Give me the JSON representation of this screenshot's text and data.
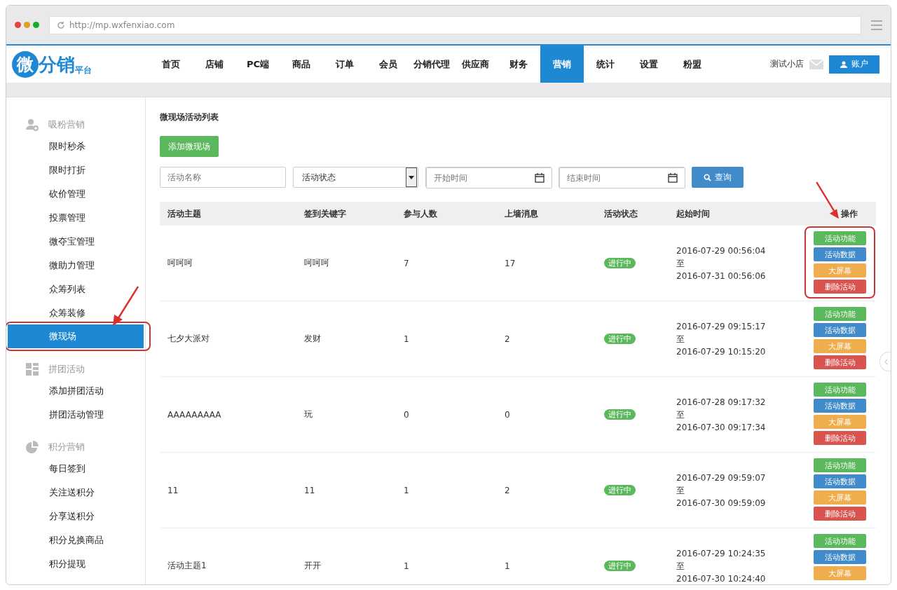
{
  "browser": {
    "url": "http://mp.wxfenxiao.com"
  },
  "header": {
    "logo": "微分销",
    "logo_sub": "平台",
    "nav": [
      {
        "label": "首页",
        "selected": false
      },
      {
        "label": "店铺",
        "selected": false
      },
      {
        "label": "PC端",
        "selected": false
      },
      {
        "label": "商品",
        "selected": false
      },
      {
        "label": "订单",
        "selected": false
      },
      {
        "label": "会员",
        "selected": false
      },
      {
        "label": "分销代理",
        "selected": false
      },
      {
        "label": "供应商",
        "selected": false
      },
      {
        "label": "财务",
        "selected": false
      },
      {
        "label": "营销",
        "selected": true
      },
      {
        "label": "统计",
        "selected": false
      },
      {
        "label": "设置",
        "selected": false
      },
      {
        "label": "粉盟",
        "selected": false
      }
    ],
    "shop": "测试小店",
    "account": "账户"
  },
  "sidebar": {
    "groups": [
      {
        "title": "吸粉营销",
        "kind": "users",
        "items": [
          {
            "label": "限时秒杀",
            "selected": false,
            "highlighted": false
          },
          {
            "label": "限时打折",
            "selected": false,
            "highlighted": false
          },
          {
            "label": "砍价管理",
            "selected": false,
            "highlighted": false
          },
          {
            "label": "投票管理",
            "selected": false,
            "highlighted": false
          },
          {
            "label": "微夺宝管理",
            "selected": false,
            "highlighted": false
          },
          {
            "label": "微助力管理",
            "selected": false,
            "highlighted": false
          },
          {
            "label": "众筹列表",
            "selected": false,
            "highlighted": false
          },
          {
            "label": "众筹装修",
            "selected": false,
            "highlighted": false
          },
          {
            "label": "微现场",
            "selected": true,
            "highlighted": true
          }
        ]
      },
      {
        "title": "拼团活动",
        "kind": "grid",
        "items": [
          {
            "label": "添加拼团活动",
            "selected": false,
            "highlighted": false
          },
          {
            "label": "拼团活动管理",
            "selected": false,
            "highlighted": false
          }
        ]
      },
      {
        "title": "积分营销",
        "kind": "pie",
        "items": [
          {
            "label": "每日签到",
            "selected": false,
            "highlighted": false
          },
          {
            "label": "关注送积分",
            "selected": false,
            "highlighted": false
          },
          {
            "label": "分享送积分",
            "selected": false,
            "highlighted": false
          },
          {
            "label": "积分兑换商品",
            "selected": false,
            "highlighted": false
          },
          {
            "label": "积分提现",
            "selected": false,
            "highlighted": false
          }
        ]
      }
    ]
  },
  "content": {
    "title": "微现场活动列表",
    "add_button": "添加微现场",
    "filters": {
      "name": {
        "placeholder": "活动名称"
      },
      "status": {
        "value": "活动状态"
      },
      "start": {
        "placeholder": "开始时间"
      },
      "end": {
        "placeholder": "结束时间"
      },
      "search": "查询"
    },
    "table": {
      "columns": [
        "活动主题",
        "签到关键字",
        "参与人数",
        "上墙消息",
        "活动状态",
        "起始时间",
        "操作"
      ],
      "actions_highlighted": true,
      "rows": [
        {
          "cells": [
            "呵呵呵",
            "呵呵呵",
            "7",
            "17"
          ],
          "status": "进行中",
          "start": "2016-07-29 00:56:04",
          "to": "至",
          "end": "2016-07-31 00:56:06",
          "highlighted": true,
          "actions": [
            {
              "label": "活动功能",
              "color": "#5cb85c"
            },
            {
              "label": "活动数据",
              "color": "#428bca"
            },
            {
              "label": "大屏幕",
              "color": "#f0ad4e"
            },
            {
              "label": "删除活动",
              "color": "#d9534f"
            }
          ]
        },
        {
          "cells": [
            "七夕大派对",
            "发财",
            "1",
            "2"
          ],
          "status": "进行中",
          "start": "2016-07-29 09:15:17",
          "to": "至",
          "end": "2016-07-29 10:15:20",
          "highlighted": false,
          "actions": [
            {
              "label": "活动功能",
              "color": "#5cb85c"
            },
            {
              "label": "活动数据",
              "color": "#428bca"
            },
            {
              "label": "大屏幕",
              "color": "#f0ad4e"
            },
            {
              "label": "删除活动",
              "color": "#d9534f"
            }
          ]
        },
        {
          "cells": [
            "AAAAAAAAA",
            "玩",
            "0",
            "0"
          ],
          "status": "进行中",
          "start": "2016-07-28 09:17:32",
          "to": "至",
          "end": "2016-07-30 09:17:34",
          "highlighted": false,
          "actions": [
            {
              "label": "活动功能",
              "color": "#5cb85c"
            },
            {
              "label": "活动数据",
              "color": "#428bca"
            },
            {
              "label": "大屏幕",
              "color": "#f0ad4e"
            },
            {
              "label": "删除活动",
              "color": "#d9534f"
            }
          ]
        },
        {
          "cells": [
            "11",
            "11",
            "1",
            "2"
          ],
          "status": "进行中",
          "start": "2016-07-29 09:59:07",
          "to": "至",
          "end": "2016-07-30 09:59:09",
          "highlighted": false,
          "actions": [
            {
              "label": "活动功能",
              "color": "#5cb85c"
            },
            {
              "label": "活动数据",
              "color": "#428bca"
            },
            {
              "label": "大屏幕",
              "color": "#f0ad4e"
            },
            {
              "label": "删除活动",
              "color": "#d9534f"
            }
          ]
        },
        {
          "cells": [
            "活动主题1",
            "开开",
            "1",
            "1"
          ],
          "status": "进行中",
          "start": "2016-07-29 10:24:35",
          "to": "至",
          "end": "2016-07-30 10:24:40",
          "highlighted": false,
          "actions": [
            {
              "label": "活动功能",
              "color": "#5cb85c"
            },
            {
              "label": "活动数据",
              "color": "#428bca"
            },
            {
              "label": "大屏幕",
              "color": "#f0ad4e"
            }
          ]
        }
      ]
    }
  }
}
